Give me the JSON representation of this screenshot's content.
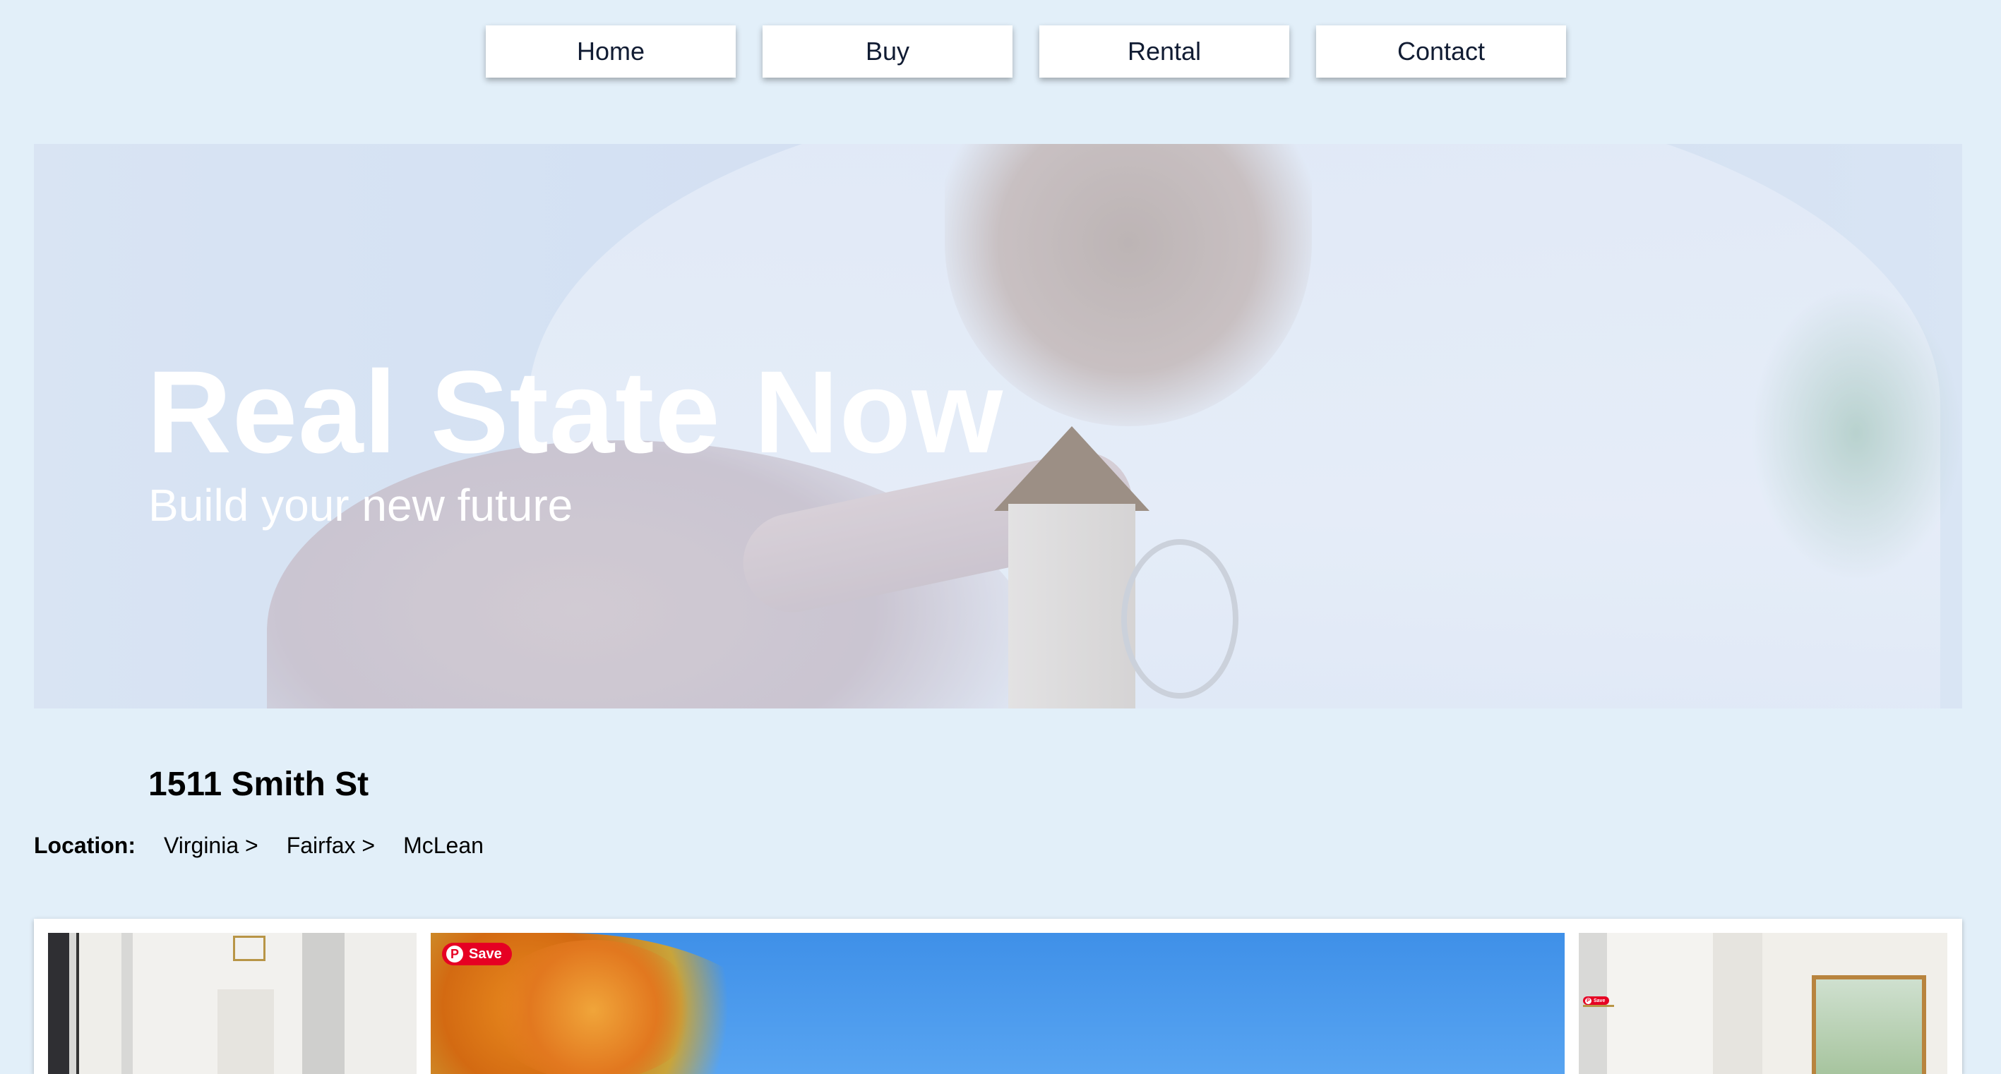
{
  "nav": {
    "items": [
      {
        "label": "Home"
      },
      {
        "label": "Buy"
      },
      {
        "label": "Rental"
      },
      {
        "label": "Contact"
      }
    ]
  },
  "hero": {
    "title": "Real State Now",
    "subtitle": "Build your new future"
  },
  "listing": {
    "address": "1511 Smith St",
    "location_label": "Location:",
    "breadcrumbs": [
      "Virginia >",
      "Fairfax >",
      "McLean"
    ]
  },
  "gallery": {
    "save_label": "Save",
    "save_label_small": "Save",
    "pin_icon": "pinterest-icon"
  },
  "colors": {
    "page_background": "#e2eff9",
    "save_badge": "#e60023",
    "nav_text": "#111c33"
  }
}
